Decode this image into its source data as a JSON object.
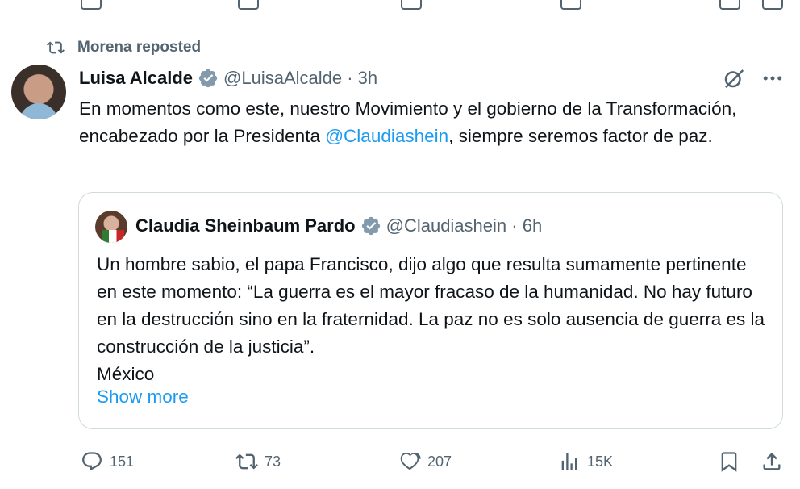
{
  "repost_banner": {
    "text": "Morena reposted"
  },
  "tweet": {
    "author_name": "Luisa Alcalde",
    "author_handle": "@LuisaAlcalde",
    "separator": " · ",
    "time": "3h",
    "text_part1": "En momentos como este, nuestro Movimiento y el gobierno de la Transformación, encabezado por la Presidenta ",
    "mention": "@Claudiashein",
    "text_part2": ", siempre seremos factor de paz."
  },
  "quote": {
    "author_name": "Claudia Sheinbaum Pardo",
    "author_handle": "@Claudiashein",
    "separator": " · ",
    "time": "6h",
    "text": "Un hombre sabio, el papa Francisco, dijo algo que resulta sumamente pertinente en este momento: “La guerra es el mayor fracaso de la humanidad. No hay futuro en la destrucción sino en la fraternidad. La paz no es solo ausencia de guerra es la construcción de la justicia”.",
    "location": "México",
    "show_more": "Show more"
  },
  "actions": {
    "replies": "151",
    "reposts": "73",
    "likes": "207",
    "views": "15K"
  },
  "colors": {
    "text": "#0f1419",
    "secondary": "#536471",
    "link": "#1d9bf0",
    "verified": "#829aab",
    "border": "#cfd9de"
  },
  "icons": {
    "repost": "repost-icon",
    "verified": "verified-badge-icon",
    "grok": "grok-icon",
    "more": "more-icon",
    "reply": "reply-icon",
    "like": "heart-icon",
    "views": "views-icon",
    "bookmark": "bookmark-icon",
    "share": "share-icon"
  }
}
